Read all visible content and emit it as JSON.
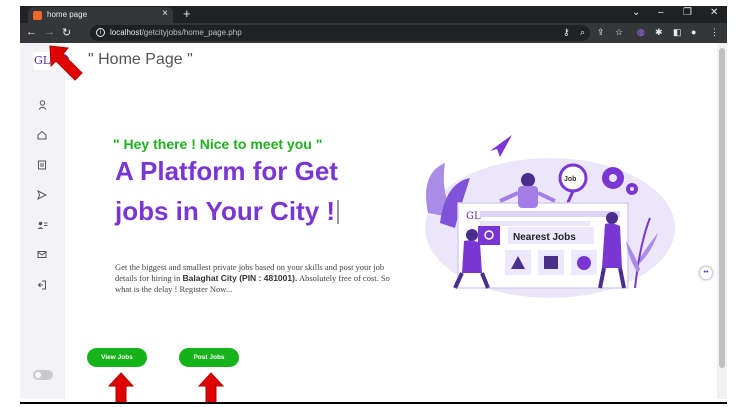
{
  "browser": {
    "tab_title": "home page",
    "url_host": "localhost",
    "url_path": "/getcityjobs/home_page.php"
  },
  "page": {
    "title": "\" Home Page \"",
    "greeting": "\" Hey there ! Nice to meet you \"",
    "headline_line1": "A Platform for Get",
    "headline_line2": "jobs in Your City !",
    "desc_part1": "Get the biggest and smallest private jobs based on your skills and post your job details for hiring in ",
    "desc_bold": "Balaghat City (PIN : 481001).",
    "desc_part2": " Absolutely free of cost. So what is the delay ! Register Now...",
    "view_jobs": "View Jobs",
    "post_jobs": "Post Jobs",
    "logo_text": "GL",
    "illustration_card_title": "Nearest Jobs",
    "illustration_bubble": "Job"
  },
  "sidebar": {
    "icons": [
      "user-icon",
      "home-icon",
      "document-icon",
      "send-icon",
      "users-icon",
      "mail-icon",
      "logout-icon"
    ]
  },
  "colors": {
    "accent": "#7a36d3",
    "green": "#16b21a",
    "annotation_arrow": "#e00000"
  }
}
